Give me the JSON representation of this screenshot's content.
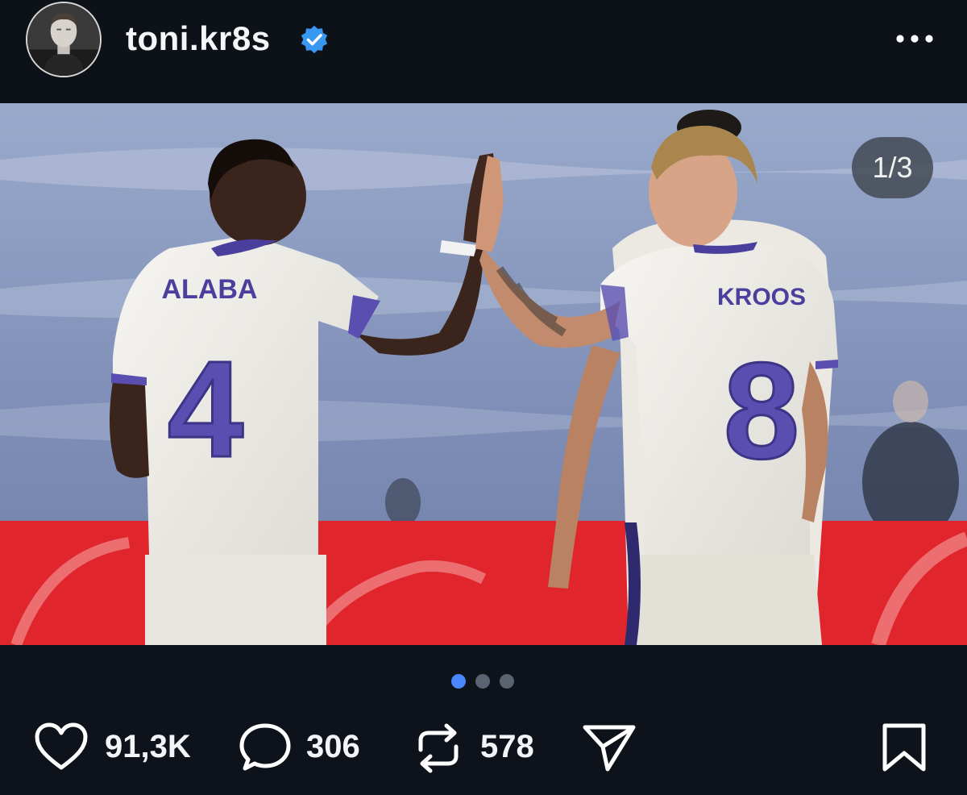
{
  "header": {
    "username": "toni.kr8s",
    "verified": true,
    "avatar_icon": "profile-photo",
    "more_icon": "more-horizontal-icon"
  },
  "post": {
    "image_description_colors": {
      "sky": "#8c9cc2",
      "ad_board": "#e0262c",
      "kit": "#f3f2ee",
      "trim": "#5a4fb0"
    },
    "jersey_left": {
      "name": "ALABA",
      "number": "4"
    },
    "jersey_right": {
      "name": "KROOS",
      "number": "8"
    },
    "page_counter": "1/3",
    "carousel": {
      "total": 3,
      "active_index": 0
    }
  },
  "actions": {
    "likes": "91,3K",
    "comments": "306",
    "reposts": "578",
    "like_icon": "heart-icon",
    "comment_icon": "comment-icon",
    "repost_icon": "repost-icon",
    "share_icon": "send-icon",
    "bookmark_icon": "bookmark-icon"
  },
  "colors": {
    "background": "#0e131b",
    "text": "#f2f4f7",
    "accent": "#4a86ff",
    "verified": "#3897f0"
  }
}
